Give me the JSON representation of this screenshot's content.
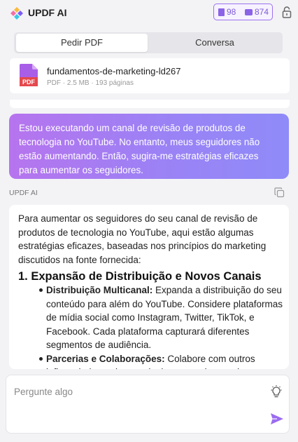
{
  "header": {
    "title": "UPDF AI",
    "counters": [
      {
        "icon": "document-icon",
        "value": "98"
      },
      {
        "icon": "chat-icon",
        "value": "874"
      }
    ]
  },
  "tabs": [
    {
      "label": "Pedir PDF",
      "active": true
    },
    {
      "label": "Conversa",
      "active": false
    }
  ],
  "file": {
    "badge": "PDF",
    "name": "fundamentos-de-marketing-ld267",
    "meta": "PDF · 2.5 MB · 193 páginas"
  },
  "user_message": "Estou executando um canal de revisão de produtos de tecnologia no YouTube. No entanto, meus seguidores não estão aumentando. Então, sugira-me estratégias eficazes para aumentar os seguidores.",
  "ai": {
    "label": "UPDF AI",
    "intro": "Para aumentar os seguidores do seu canal de revisão de produtos de tecnologia no YouTube, aqui estão algumas estratégias eficazes, baseadas nos princípios do marketing discutidos na fonte fornecida:",
    "heading": "1. Expansão de Distribuição e Novos Canais",
    "bullets": [
      {
        "title": "Distribuição Multicanal:",
        "text": " Expanda a distribuição do seu conteúdo para além do YouTube. Considere plataformas de mídia social como Instagram, Twitter, TikTok, e Facebook. Cada plataforma capturará diferentes segmentos de audiência."
      },
      {
        "title": "Parcerias e Colaborações:",
        "text": " Colabore com outros influenciadores de tecnologia ou canais complementares"
      }
    ]
  },
  "input": {
    "placeholder": "Pergunte algo",
    "value": ""
  },
  "colors": {
    "accent": "#8a63e6",
    "gradient_start": "#b674ee",
    "gradient_end": "#8f8bf8",
    "pdf_red": "#e5484d"
  }
}
